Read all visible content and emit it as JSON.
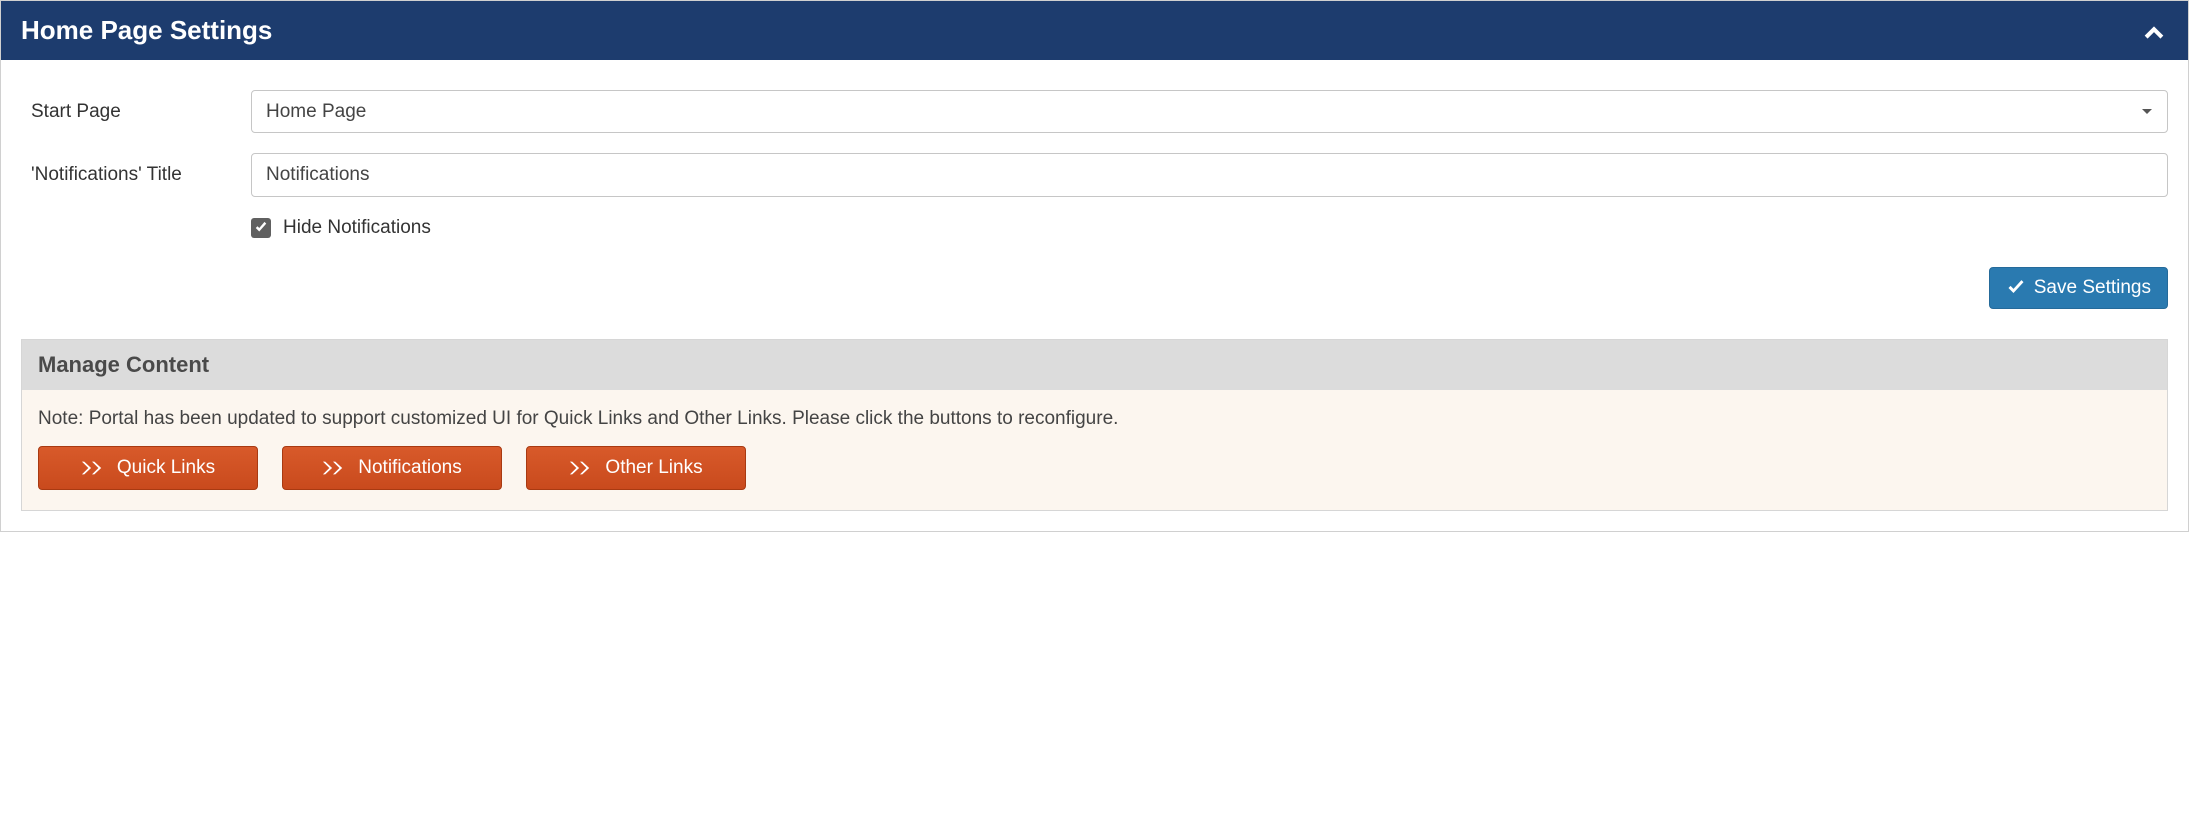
{
  "panel": {
    "title": "Home Page Settings"
  },
  "form": {
    "start_page_label": "Start Page",
    "start_page_value": "Home Page",
    "notifications_title_label": "'Notifications' Title",
    "notifications_title_value": "Notifications",
    "hide_notifications_label": "Hide Notifications",
    "hide_notifications_checked": true,
    "save_button_label": "Save Settings"
  },
  "manage_content": {
    "title": "Manage Content",
    "note": "Note: Portal has been updated to support customized UI for Quick Links and Other Links. Please click the buttons to reconfigure.",
    "buttons": {
      "quick_links": "Quick Links",
      "notifications": "Notifications",
      "other_links": "Other Links"
    }
  }
}
